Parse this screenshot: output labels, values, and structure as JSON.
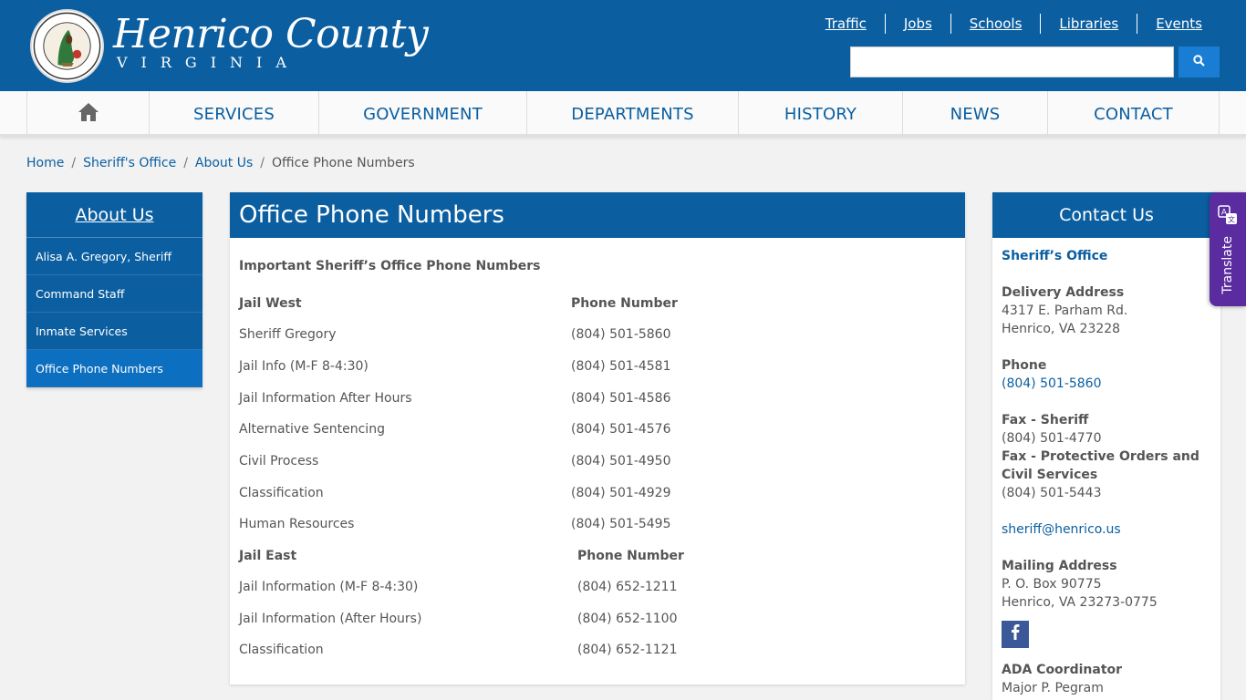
{
  "header": {
    "title_line1": "Henrico County",
    "title_line2": "VIRGINIA",
    "top_links": [
      "Traffic",
      "Jobs",
      "Schools",
      "Libraries",
      "Events"
    ],
    "search_placeholder": ""
  },
  "nav": {
    "items": [
      "SERVICES",
      "GOVERNMENT",
      "DEPARTMENTS",
      "HISTORY",
      "NEWS",
      "CONTACT"
    ]
  },
  "breadcrumb": {
    "links": [
      "Home",
      "Sheriff's Office",
      "About Us"
    ],
    "current": "Office Phone Numbers"
  },
  "sidebar": {
    "title": "About Us",
    "items": [
      "Alisa A. Gregory, Sheriff",
      "Command Staff",
      "Inmate Services",
      "Office Phone Numbers"
    ]
  },
  "main": {
    "title": "Office Phone Numbers",
    "subhead": "Important Sheriff’s Office Phone Numbers",
    "jail_west": {
      "header": [
        "Jail West",
        "Phone Number"
      ],
      "rows": [
        [
          "Sheriff Gregory",
          "(804) 501-5860"
        ],
        [
          "Jail Info (M-F 8-4:30)",
          "(804) 501-4581"
        ],
        [
          "Jail Information After Hours",
          "(804) 501-4586"
        ],
        [
          "Alternative Sentencing",
          "(804) 501-4576"
        ],
        [
          "Civil Process",
          "(804) 501-4950"
        ],
        [
          "Classification",
          "(804) 501-4929"
        ],
        [
          "Human Resources",
          "(804) 501-5495"
        ]
      ]
    },
    "jail_east": {
      "header": [
        "Jail East",
        "Phone Number"
      ],
      "rows": [
        [
          "Jail Information (M-F 8-4:30)",
          "(804) 652-1211"
        ],
        [
          "Jail Information (After Hours)",
          "(804) 652-1100"
        ],
        [
          "Classification",
          "(804) 652-1121"
        ]
      ]
    }
  },
  "contact": {
    "title": "Contact Us",
    "org": "Sheriff’s Office",
    "delivery_label": "Delivery Address",
    "delivery_line1": "4317 E. Parham Rd.",
    "delivery_line2": "Henrico, VA 23228",
    "phone_label": "Phone",
    "phone": "(804) 501-5860",
    "fax_sheriff_label": "Fax - Sheriff",
    "fax_sheriff": "(804) 501-4770",
    "fax_po_label": "Fax - Protective Orders and Civil Services",
    "fax_po": "(804) 501-5443",
    "email": "sheriff@henrico.us",
    "mailing_label": "Mailing Address",
    "mailing_line1": "P. O. Box 90775",
    "mailing_line2": "Henrico, VA 23273-0775",
    "ada_label": "ADA Coordinator",
    "ada_name": "Major P. Pegram"
  },
  "translate": {
    "label": "Translate"
  },
  "colors": {
    "brand_blue": "#0b5fa1",
    "search_blue": "#1a7dd4",
    "translate_purple": "#5a2ca0",
    "facebook": "#3b5998"
  }
}
